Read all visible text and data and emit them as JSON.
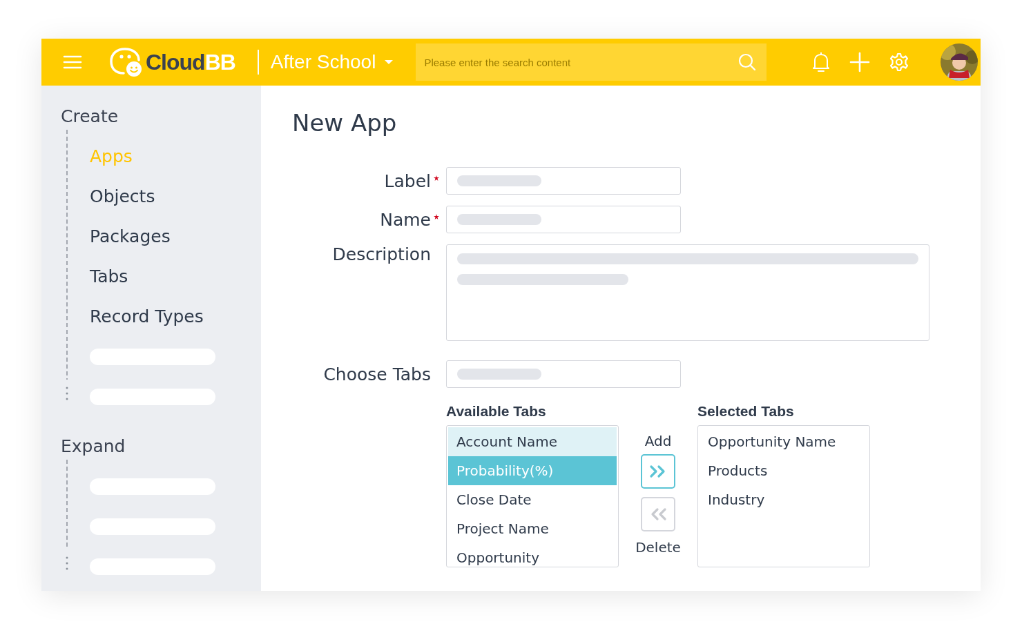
{
  "header": {
    "logo": {
      "parts": [
        "Cloud",
        "BB"
      ]
    },
    "workspace": "After School",
    "search": {
      "placeholder": "Please enter the search content"
    }
  },
  "sidebar": {
    "groups": [
      {
        "title": "Create",
        "items": [
          {
            "kind": "link",
            "label": "Apps",
            "selected": true
          },
          {
            "kind": "link",
            "label": "Objects",
            "selected": false
          },
          {
            "kind": "link",
            "label": "Packages",
            "selected": false
          },
          {
            "kind": "link",
            "label": "Tabs",
            "selected": false
          },
          {
            "kind": "link",
            "label": "Record Types",
            "selected": false
          },
          {
            "kind": "placeholder"
          },
          {
            "kind": "placeholder"
          }
        ]
      },
      {
        "title": "Expand",
        "items": [
          {
            "kind": "placeholder"
          },
          {
            "kind": "placeholder"
          },
          {
            "kind": "placeholder"
          }
        ]
      }
    ]
  },
  "main": {
    "title": "New App",
    "fields": [
      {
        "label": "Label",
        "required": true,
        "kind": "input"
      },
      {
        "label": "Name",
        "required": true,
        "kind": "input"
      },
      {
        "label": "Description",
        "required": false,
        "kind": "textarea"
      },
      {
        "label": "Choose Tabs",
        "required": false,
        "kind": "input"
      }
    ],
    "available": {
      "title": "Available Tabs",
      "items": [
        {
          "label": "Account Name",
          "hovered": true,
          "selected": false
        },
        {
          "label": "Probability(%)",
          "hovered": false,
          "selected": true
        },
        {
          "label": "Close Date",
          "hovered": false,
          "selected": false
        },
        {
          "label": "Project Name",
          "hovered": false,
          "selected": false
        },
        {
          "label": "Opportunity",
          "hovered": false,
          "selected": false
        }
      ]
    },
    "add": {
      "label": "Add",
      "disabled": false
    },
    "delete": {
      "label": "Delete",
      "disabled": true
    },
    "selected_tabs": {
      "title": "Selected Tabs",
      "items": [
        {
          "label": "Opportunity Name"
        },
        {
          "label": "Products"
        },
        {
          "label": "Industry"
        }
      ]
    }
  }
}
